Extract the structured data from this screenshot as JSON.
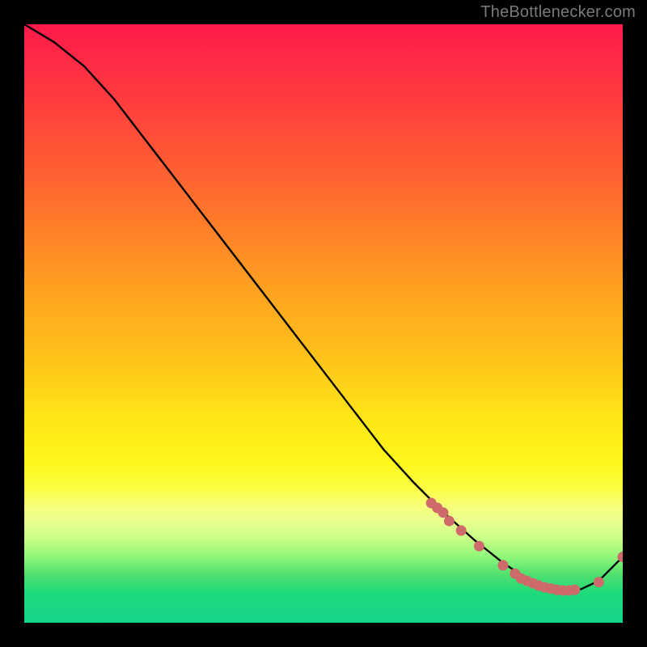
{
  "attribution": "TheBottlenecker.com",
  "colors": {
    "curve": "#000000",
    "marker": "#cf6a6a",
    "background_black": "#000000"
  },
  "chart_data": {
    "type": "line",
    "title": "",
    "xlabel": "",
    "ylabel": "",
    "xlim": [
      0,
      100
    ],
    "ylim": [
      0,
      100
    ],
    "grid": false,
    "legend": false,
    "series": [
      {
        "name": "bottleneck-curve",
        "x": [
          0,
          5,
          10,
          15,
          20,
          25,
          30,
          35,
          40,
          45,
          50,
          55,
          60,
          65,
          70,
          75,
          80,
          83,
          86,
          88,
          90,
          93,
          96,
          100
        ],
        "y": [
          100,
          97,
          93,
          87.5,
          81,
          74.5,
          68,
          61.5,
          55,
          48.5,
          42,
          35.5,
          29,
          23.5,
          18.5,
          14,
          10,
          8,
          6.5,
          5.8,
          5.4,
          5.6,
          7,
          11
        ]
      }
    ],
    "markers": [
      {
        "x": 68,
        "y": 20.0
      },
      {
        "x": 69,
        "y": 19.2
      },
      {
        "x": 70,
        "y": 18.4
      },
      {
        "x": 71,
        "y": 17.0
      },
      {
        "x": 73,
        "y": 15.4
      },
      {
        "x": 76,
        "y": 12.8
      },
      {
        "x": 80,
        "y": 9.6
      },
      {
        "x": 82,
        "y": 8.2
      },
      {
        "x": 83,
        "y": 7.4
      },
      {
        "x": 84,
        "y": 7.0
      },
      {
        "x": 85,
        "y": 6.6
      },
      {
        "x": 86,
        "y": 6.2
      },
      {
        "x": 87,
        "y": 5.9
      },
      {
        "x": 88,
        "y": 5.7
      },
      {
        "x": 89,
        "y": 5.5
      },
      {
        "x": 90,
        "y": 5.4
      },
      {
        "x": 91,
        "y": 5.4
      },
      {
        "x": 92,
        "y": 5.5
      },
      {
        "x": 96,
        "y": 6.8
      },
      {
        "x": 100,
        "y": 11.0
      }
    ],
    "gradient_stops": [
      {
        "pos": 0,
        "color": "#ff1a4b"
      },
      {
        "pos": 50,
        "color": "#ffd21a"
      },
      {
        "pos": 80,
        "color": "#fcff42"
      },
      {
        "pos": 100,
        "color": "#15d58c"
      }
    ]
  }
}
